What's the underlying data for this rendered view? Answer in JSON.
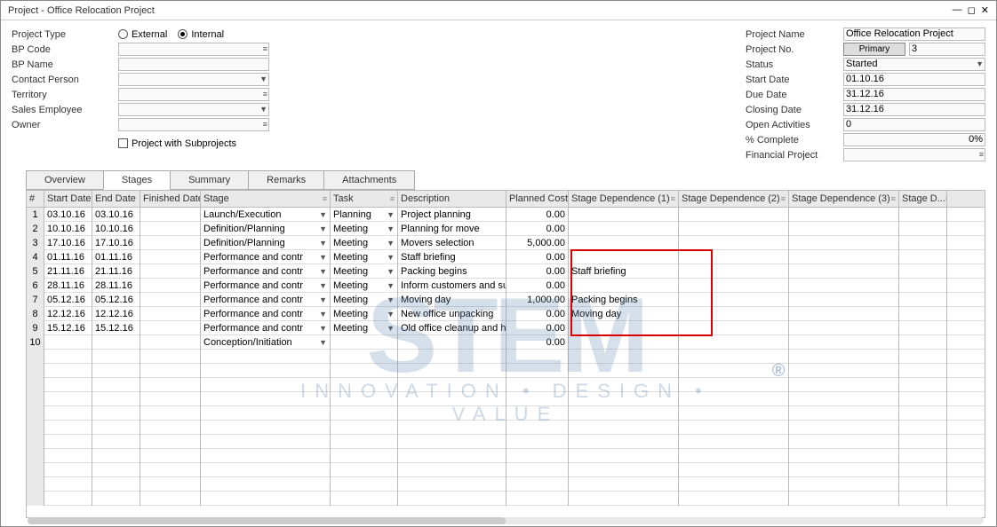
{
  "window": {
    "title": "Project - Office Relocation Project"
  },
  "left": {
    "project_type": "Project Type",
    "external": "External",
    "internal": "Internal",
    "bp_code": "BP Code",
    "bp_name": "BP Name",
    "contact": "Contact Person",
    "territory": "Territory",
    "sales_emp": "Sales Employee",
    "owner": "Owner",
    "proj_sub": "Project with Subprojects"
  },
  "right": {
    "proj_name_label": "Project Name",
    "proj_name_val": "Office Relocation Project",
    "proj_no_label": "Project No.",
    "primary_btn": "Primary",
    "proj_no_val": "3",
    "status_label": "Status",
    "status_val": "Started",
    "start_label": "Start Date",
    "start_val": "01.10.16",
    "due_label": "Due Date",
    "due_val": "31.12.16",
    "closing_label": "Closing Date",
    "closing_val": "31.12.16",
    "open_label": "Open Activities",
    "open_val": "0",
    "pct_label": "% Complete",
    "pct_val": "0%",
    "fin_label": "Financial Project"
  },
  "tabs": [
    "Overview",
    "Stages",
    "Summary",
    "Remarks",
    "Attachments"
  ],
  "headers": [
    "#",
    "Start Date",
    "End Date",
    "Finished Date",
    "Stage",
    "Task",
    "Description",
    "Planned Cost",
    "Stage Dependence (1)",
    "Stage Dependence (2)",
    "Stage Dependence (3)",
    "Stage D..."
  ],
  "rows": [
    {
      "n": "1",
      "sd": "03.10.16",
      "ed": "03.10.16",
      "fd": "",
      "stage": "Launch/Execution",
      "task": "Planning",
      "desc": "Project planning",
      "cost": "0.00",
      "dep1": "",
      "dep2": "",
      "dep3": ""
    },
    {
      "n": "2",
      "sd": "10.10.16",
      "ed": "10.10.16",
      "fd": "",
      "stage": "Definition/Planning",
      "task": "Meeting",
      "desc": "Planning for move",
      "cost": "0.00",
      "dep1": "",
      "dep2": "",
      "dep3": ""
    },
    {
      "n": "3",
      "sd": "17.10.16",
      "ed": "17.10.16",
      "fd": "",
      "stage": "Definition/Planning",
      "task": "Meeting",
      "desc": "Movers selection",
      "cost": "5,000.00",
      "dep1": "",
      "dep2": "",
      "dep3": ""
    },
    {
      "n": "4",
      "sd": "01.11.16",
      "ed": "01.11.16",
      "fd": "",
      "stage": "Performance and contr",
      "task": "Meeting",
      "desc": "Staff briefing",
      "cost": "0.00",
      "dep1": "",
      "dep2": "",
      "dep3": ""
    },
    {
      "n": "5",
      "sd": "21.11.16",
      "ed": "21.11.16",
      "fd": "",
      "stage": "Performance and contr",
      "task": "Meeting",
      "desc": "Packing begins",
      "cost": "0.00",
      "dep1": "Staff briefing",
      "dep2": "",
      "dep3": ""
    },
    {
      "n": "6",
      "sd": "28.11.16",
      "ed": "28.11.16",
      "fd": "",
      "stage": "Performance and contr",
      "task": "Meeting",
      "desc": "Inform customers and sup",
      "cost": "0.00",
      "dep1": "",
      "dep2": "",
      "dep3": ""
    },
    {
      "n": "7",
      "sd": "05.12.16",
      "ed": "05.12.16",
      "fd": "",
      "stage": "Performance and contr",
      "task": "Meeting",
      "desc": "Moving day",
      "cost": "1,000.00",
      "dep1": "Packing begins",
      "dep2": "",
      "dep3": ""
    },
    {
      "n": "8",
      "sd": "12.12.16",
      "ed": "12.12.16",
      "fd": "",
      "stage": "Performance and contr",
      "task": "Meeting",
      "desc": "New office unpacking",
      "cost": "0.00",
      "dep1": "Moving day",
      "dep2": "",
      "dep3": ""
    },
    {
      "n": "9",
      "sd": "15.12.16",
      "ed": "15.12.16",
      "fd": "",
      "stage": "Performance and contr",
      "task": "Meeting",
      "desc": "Old office cleanup and han",
      "cost": "0.00",
      "dep1": "",
      "dep2": "",
      "dep3": ""
    },
    {
      "n": "10",
      "sd": "",
      "ed": "",
      "fd": "",
      "stage": "Conception/Initiation",
      "task": "",
      "desc": "",
      "cost": "0.00",
      "dep1": "",
      "dep2": "",
      "dep3": ""
    }
  ]
}
